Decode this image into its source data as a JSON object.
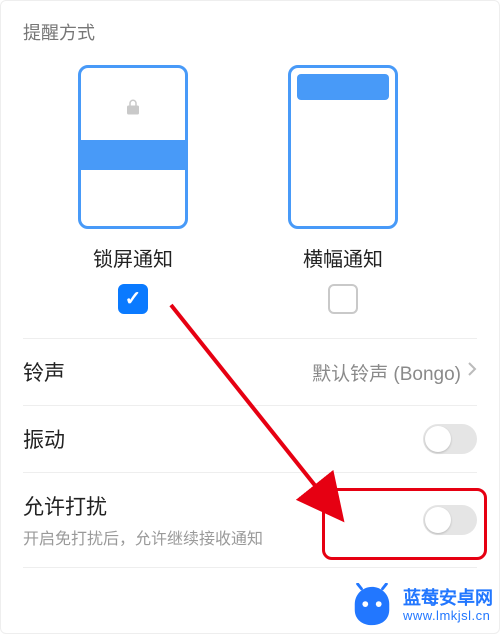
{
  "section_title": "提醒方式",
  "options": {
    "lockscreen": {
      "label": "锁屏通知",
      "checked": true
    },
    "banner": {
      "label": "横幅通知",
      "checked": false
    }
  },
  "rows": {
    "ringtone": {
      "label": "铃声",
      "value": "默认铃声 (Bongo)"
    },
    "vibration": {
      "label": "振动",
      "on": false
    },
    "allow_disturb": {
      "label": "允许打扰",
      "sub": "开启免打扰后，允许继续接收通知",
      "on": false
    }
  },
  "watermark": {
    "title": "蓝莓安卓网",
    "url": "www.lmkjsl.cn"
  },
  "colors": {
    "accent": "#0a7aff",
    "phone_border": "#489af8",
    "highlight": "#e60012"
  }
}
